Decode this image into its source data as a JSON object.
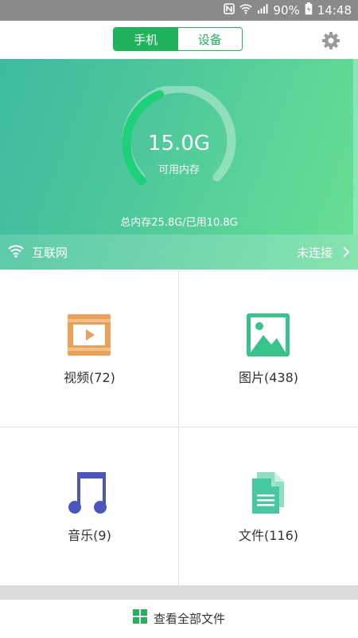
{
  "status_bar": {
    "battery": "90%",
    "time": "14:48"
  },
  "tabs": [
    {
      "label": "手机"
    },
    {
      "label": "设备"
    }
  ],
  "storage": {
    "available": "15.0G",
    "caption": "可用内存",
    "summary": "总内存25.8G/已用10.8G",
    "used_fraction": 0.42
  },
  "network": {
    "label": "互联网",
    "status": "未连接"
  },
  "categories": [
    {
      "label": "视频(72)"
    },
    {
      "label": "图片(438)"
    },
    {
      "label": "音乐(9)"
    },
    {
      "label": "文件(116)"
    }
  ],
  "bottom": {
    "label": "查看全部文件"
  },
  "colors": {
    "brand": "#21b25c",
    "video": "#e9a15a",
    "image": "#36c48a",
    "music": "#4a56be",
    "file": "#46c9a0"
  }
}
